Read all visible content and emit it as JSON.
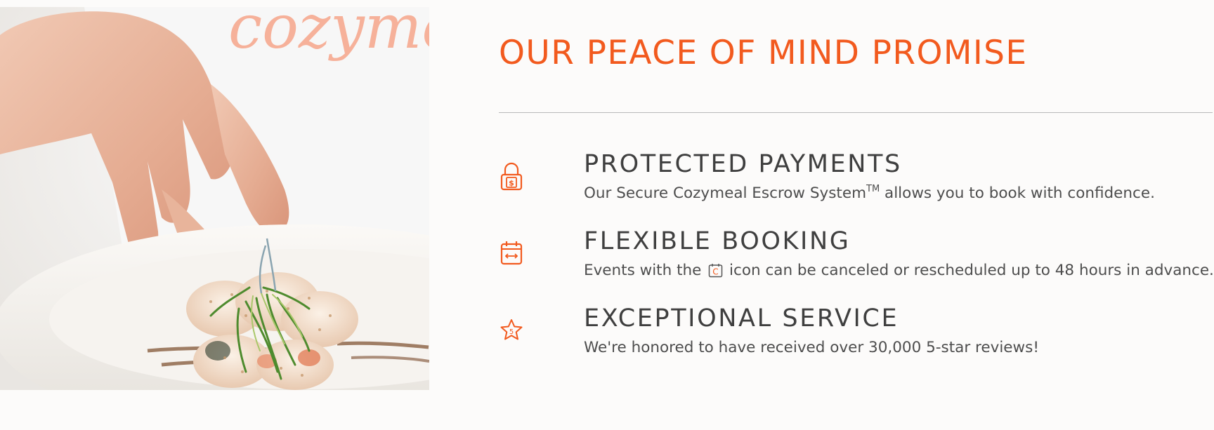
{
  "photo": {
    "alt": "Chef garnishing sushi rolls with scallions",
    "apron_text": "cozyme"
  },
  "promise": {
    "title": "OUR PEACE OF MIND PROMISE",
    "accent_color": "#f25a1e",
    "items": [
      {
        "icon": "padlock-dollar-icon",
        "title": "PROTECTED PAYMENTS",
        "desc_before": "Our Secure Cozymeal Escrow System",
        "desc_sup": "TM",
        "desc_after": " allows you to book with confidence."
      },
      {
        "icon": "calendar-arrows-icon",
        "title": "FLEXIBLE BOOKING",
        "desc_before": "Events with the ",
        "inline_icon": "c-calendar-icon",
        "inline_icon_letter": "C",
        "desc_after": " icon can be canceled or rescheduled up to 48 hours in advance."
      },
      {
        "icon": "star-five-icon",
        "icon_digit": "5",
        "title": "EXCEPTIONAL SERVICE",
        "desc": "We're honored to have received over 30,000 5-star reviews!"
      }
    ]
  }
}
